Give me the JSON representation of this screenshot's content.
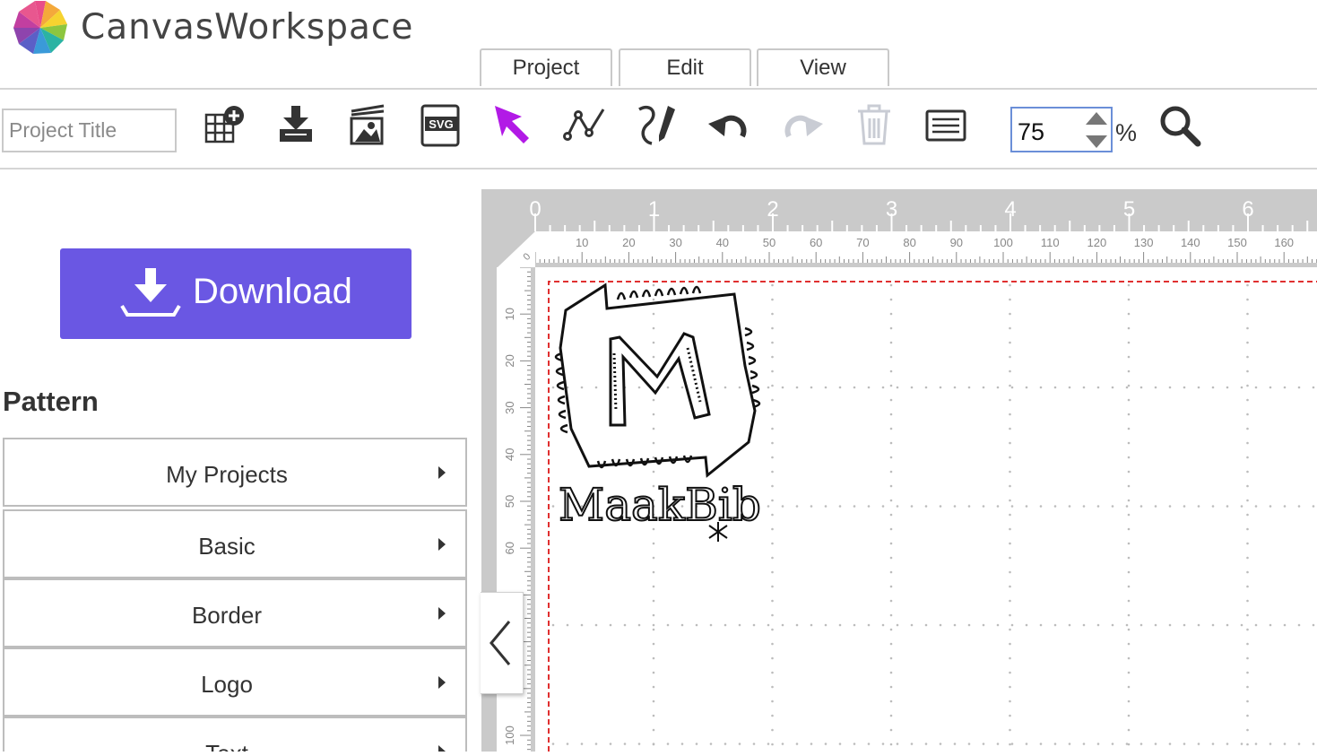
{
  "app": {
    "title": "CanvasWorkspace",
    "logo_icon": "pinwheel-logo-icon"
  },
  "menu": {
    "tabs": [
      "Project",
      "Edit",
      "View"
    ]
  },
  "toolbar": {
    "title_placeholder": "Project Title",
    "tools": [
      {
        "name": "add-pattern-icon",
        "state": "enabled"
      },
      {
        "name": "import-icon",
        "state": "enabled"
      },
      {
        "name": "import-image-icon",
        "state": "enabled"
      },
      {
        "name": "svg-export-icon",
        "state": "enabled",
        "label": "SVG"
      },
      {
        "name": "select-arrow-icon",
        "state": "active"
      },
      {
        "name": "node-edit-icon",
        "state": "enabled"
      },
      {
        "name": "draw-pen-icon",
        "state": "enabled"
      },
      {
        "name": "undo-icon",
        "state": "enabled"
      },
      {
        "name": "redo-icon",
        "state": "disabled"
      },
      {
        "name": "trash-icon",
        "state": "disabled"
      },
      {
        "name": "text-lines-icon",
        "state": "enabled"
      }
    ],
    "zoom": {
      "value": "75",
      "unit": "%"
    },
    "search_icon": "magnifier-icon"
  },
  "sidebar": {
    "download_label": "Download",
    "pattern_heading": "Pattern",
    "categories": [
      "My Projects",
      "Basic",
      "Border",
      "Logo",
      "Text"
    ]
  },
  "canvas": {
    "ruler_inches": [
      "0",
      "1",
      "2",
      "3",
      "4",
      "5",
      "6"
    ],
    "ruler_mm_top": [
      "10",
      "20",
      "30",
      "40",
      "50",
      "60",
      "70",
      "80",
      "90",
      "100",
      "110",
      "120",
      "130",
      "140",
      "150",
      "160"
    ],
    "ruler_mm_left": [
      "10",
      "20",
      "30",
      "40",
      "50",
      "60",
      "100"
    ],
    "corner_label": "0",
    "artwork_text": "MaakBib"
  },
  "colors": {
    "accent": "#6a57e3",
    "select_tool": "#b21ae6",
    "zoom_border": "#6b8fd8",
    "cut_line": "#e03030"
  }
}
